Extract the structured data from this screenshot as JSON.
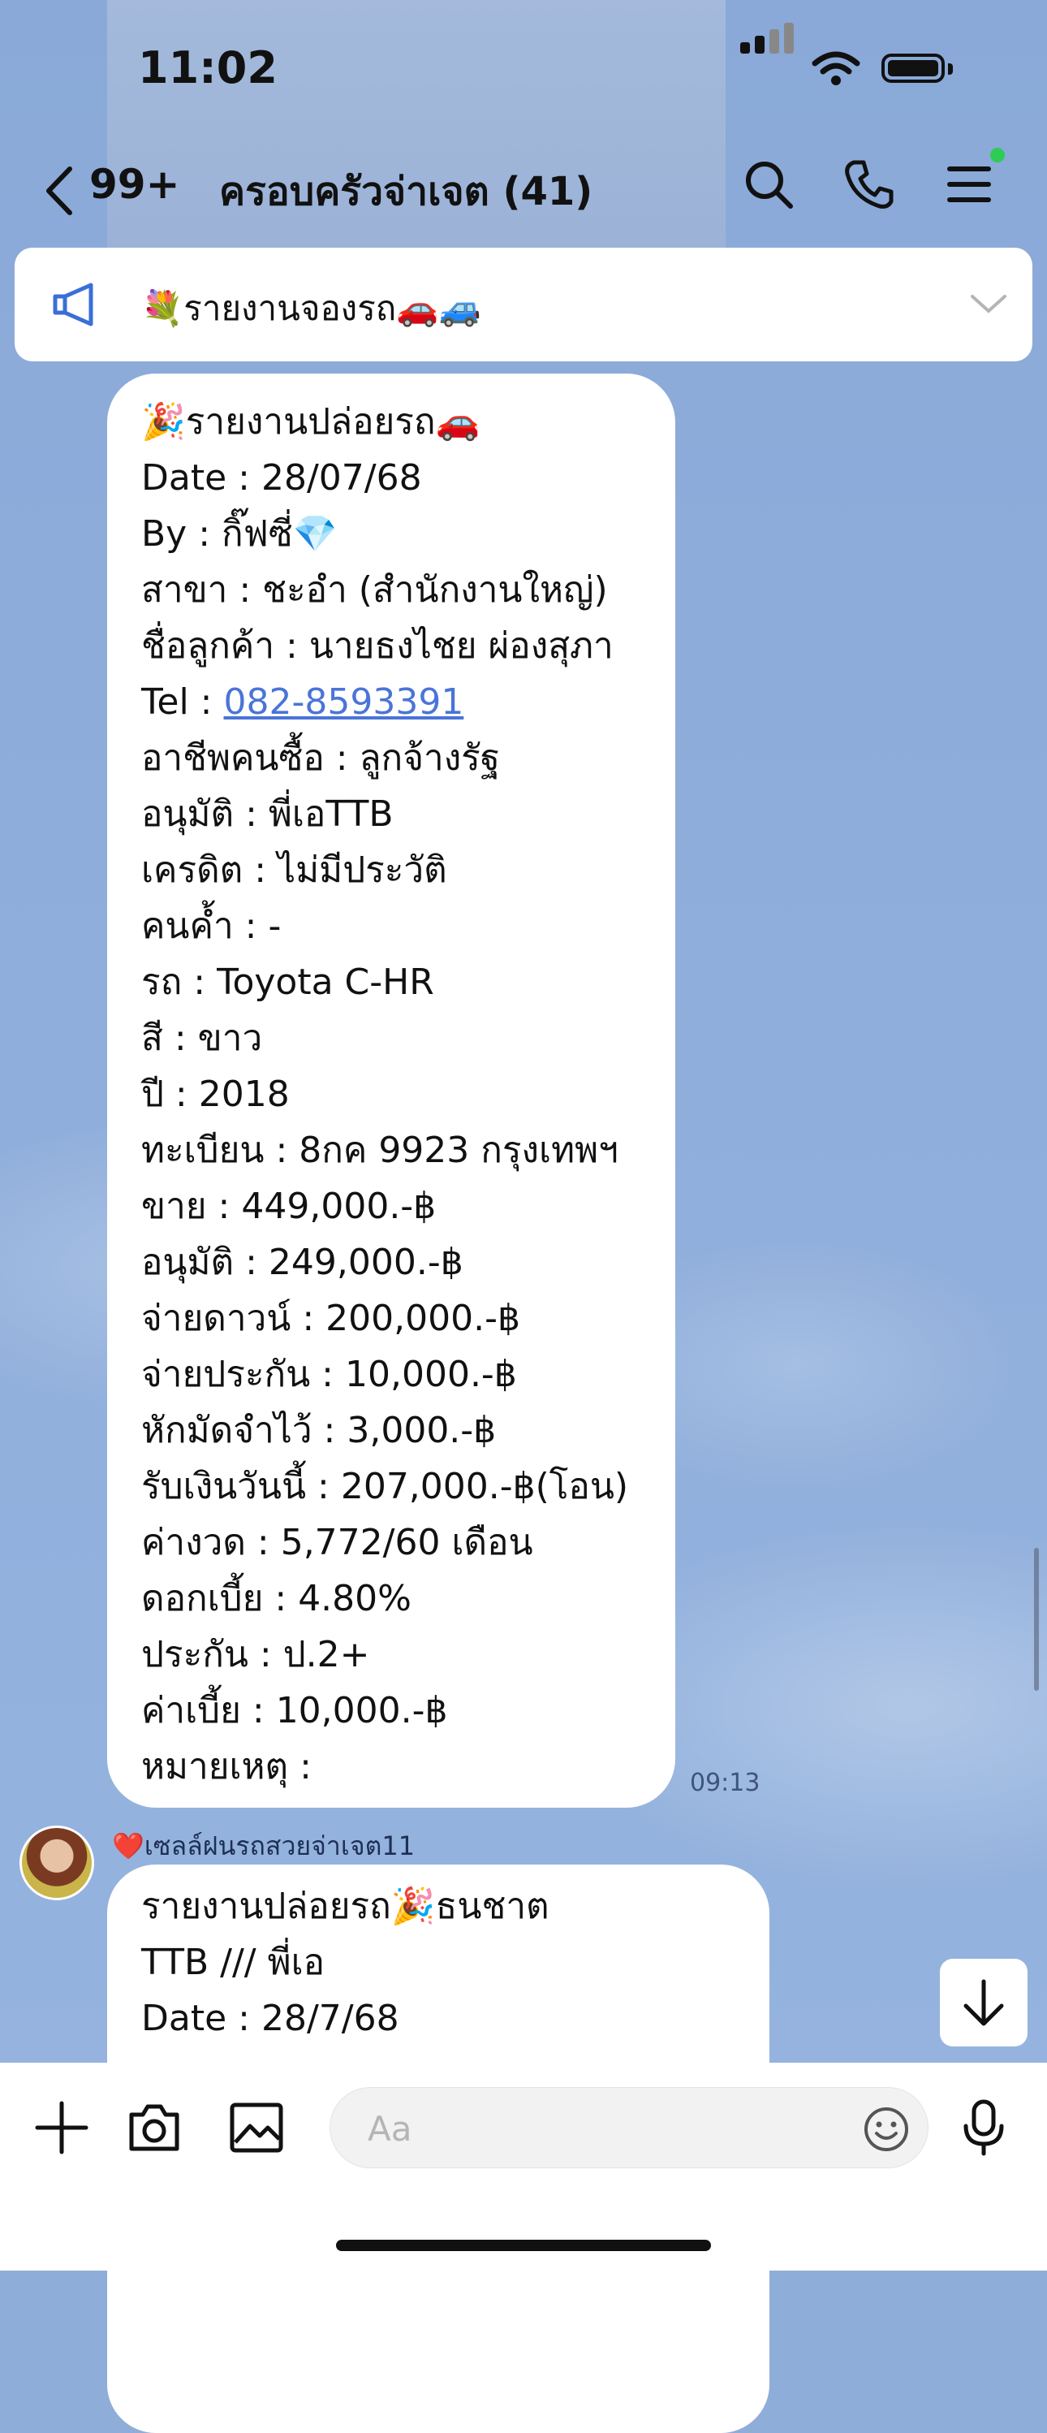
{
  "status_bar": {
    "time": "11:02"
  },
  "header": {
    "back_count": "99+",
    "title": "ครอบครัวจ่าเจต (41)"
  },
  "announcement": {
    "text": "💐รายงานจองรถ🚗🚙"
  },
  "messages": [
    {
      "time": "09:13",
      "lines": [
        "🎉รายงานปล่อยรถ🚗",
        "Date : 28/07/68",
        "By : กิ๊ฟซี่💎",
        "สาขา : ชะอำ (สำนักงานใหญ่)",
        "ชื่อลูกค้า : นายธงไชย ผ่องสุภา",
        "Tel : ",
        "อาชีพคนซื้อ : ลูกจ้างรัฐ",
        "อนุมัติ : พี่เอTTB",
        "เครดิต : ไม่มีประวัติ",
        "คนค้ำ : -",
        "รถ : Toyota C-HR",
        "สี : ขาว",
        "ปี : 2018",
        "ทะเบียน : 8กค 9923 กรุงเทพฯ",
        "ขาย : 449,000.-฿",
        "อนุมัติ : 249,000.-฿",
        "จ่ายดาวน์ : 200,000.-฿",
        "จ่ายประกัน : 10,000.-฿",
        "หักมัดจำไว้ : 3,000.-฿",
        "รับเงินวันนี้ : 207,000.-฿(โอน)",
        "ค่างวด : 5,772/60 เดือน",
        "ดอกเบี้ย : 4.80%",
        "ประกัน : ป.2+",
        "ค่าเบี้ย : 10,000.-฿",
        "หมายเหตุ :"
      ],
      "tel_link": "082-8593391"
    },
    {
      "sender": "❤️เซลล์ฝนรถสวยจ่าเจต11",
      "lines": [
        " รายงานปล่อยรถ🎉ธนชาต",
        "TTB /// พี่เอ",
        "Date : 28/7/68"
      ]
    }
  ],
  "composer": {
    "placeholder": "Aa"
  }
}
